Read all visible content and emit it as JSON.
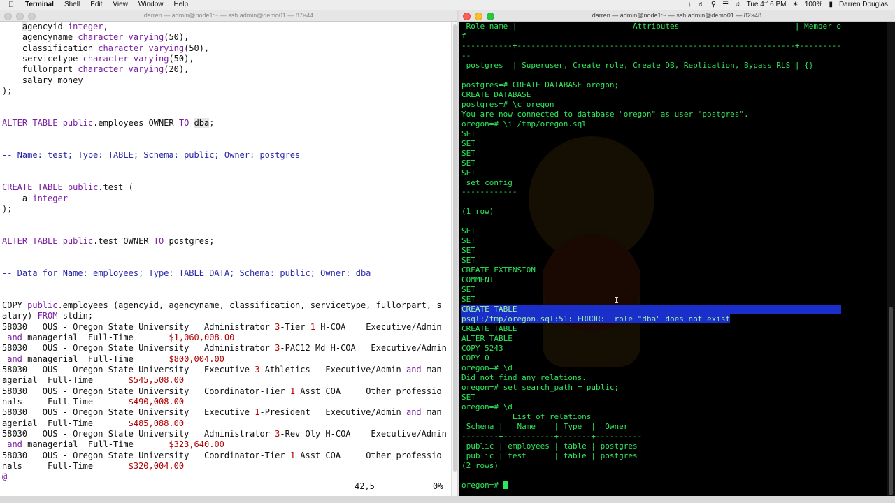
{
  "menubar": {
    "app": "Terminal",
    "menus": [
      "Shell",
      "Edit",
      "View",
      "Window",
      "Help"
    ],
    "clock": "Tue 4:16 PM",
    "battery": "100%",
    "user": "Darren Douglas"
  },
  "left_window": {
    "title": "darren — admin@node1:~ — ssh admin@demo01 — 87×44",
    "status_pos": "42,5",
    "status_pct": "0%"
  },
  "right_window": {
    "title": "darren — admin@node1:~ — ssh admin@demo01 — 82×48"
  },
  "vim_lines": [
    [
      {
        "t": "    "
      },
      {
        "t": "a",
        "c": "hl"
      },
      {
        "t": "gencyid "
      },
      {
        "t": "integer",
        "c": "kw"
      },
      {
        "t": ","
      }
    ],
    [
      {
        "t": "    agencyname "
      },
      {
        "t": "character varying",
        "c": "kw"
      },
      {
        "t": "("
      },
      {
        "t": "50",
        "c": ""
      },
      {
        "t": "),"
      }
    ],
    [
      {
        "t": "    classification "
      },
      {
        "t": "character varying",
        "c": "kw"
      },
      {
        "t": "(50),"
      }
    ],
    [
      {
        "t": "    servicetype "
      },
      {
        "t": "character varying",
        "c": "kw"
      },
      {
        "t": "(50),"
      }
    ],
    [
      {
        "t": "    fullorpart "
      },
      {
        "t": "character varying",
        "c": "kw"
      },
      {
        "t": "(20),"
      }
    ],
    [
      {
        "t": "    salary money"
      }
    ],
    [
      {
        "t": ");"
      }
    ],
    [
      {
        "t": ""
      }
    ],
    [
      {
        "t": ""
      }
    ],
    [
      {
        "t": "ALTER TABLE ",
        "c": "kw"
      },
      {
        "t": "public",
        "c": "kw"
      },
      {
        "t": ".employees OWNER "
      },
      {
        "t": "TO",
        "c": "kw"
      },
      {
        "t": " "
      },
      {
        "t": "dba",
        "c": "hl"
      },
      {
        "t": ";"
      }
    ],
    [
      {
        "t": ""
      }
    ],
    [
      {
        "t": "--",
        "c": "cm"
      }
    ],
    [
      {
        "t": "-- Name: test; Type: TABLE; Schema: public; Owner: postgres",
        "c": "cm"
      }
    ],
    [
      {
        "t": "--",
        "c": "cm"
      }
    ],
    [
      {
        "t": ""
      }
    ],
    [
      {
        "t": "CREATE TABLE ",
        "c": "kw"
      },
      {
        "t": "public",
        "c": "kw"
      },
      {
        "t": ".test ("
      }
    ],
    [
      {
        "t": "    a "
      },
      {
        "t": "integer",
        "c": "kw"
      }
    ],
    [
      {
        "t": ");"
      }
    ],
    [
      {
        "t": ""
      }
    ],
    [
      {
        "t": ""
      }
    ],
    [
      {
        "t": "ALTER TABLE ",
        "c": "kw"
      },
      {
        "t": "public",
        "c": "kw"
      },
      {
        "t": ".test OWNER "
      },
      {
        "t": "TO",
        "c": "kw"
      },
      {
        "t": " postgres;"
      }
    ],
    [
      {
        "t": ""
      }
    ],
    [
      {
        "t": "--",
        "c": "cm"
      }
    ],
    [
      {
        "t": "-- Data for Name: employees; Type: TABLE DATA; Schema: public; Owner: dba",
        "c": "cm"
      }
    ],
    [
      {
        "t": "--",
        "c": "cm"
      }
    ],
    [
      {
        "t": ""
      }
    ],
    [
      {
        "t": "COPY "
      },
      {
        "t": "public",
        "c": "kw"
      },
      {
        "t": ".employees (agencyid, agencyname, classification, servicetype, fullorpart, s"
      }
    ],
    [
      {
        "t": "alary) "
      },
      {
        "t": "FROM",
        "c": "kw"
      },
      {
        "t": " stdin;"
      }
    ],
    [
      {
        "t": "58030   OUS - Oregon State University   Administrator "
      },
      {
        "t": "3",
        "c": "num"
      },
      {
        "t": "-Tier "
      },
      {
        "t": "1",
        "c": "num"
      },
      {
        "t": " H-COA    Executive/Admin"
      }
    ],
    [
      {
        "t": " "
      },
      {
        "t": "and",
        "c": "kw"
      },
      {
        "t": " managerial  Full-Time       "
      },
      {
        "t": "$1,060,008.00",
        "c": "num"
      }
    ],
    [
      {
        "t": "58030   OUS - Oregon State University   Administrator "
      },
      {
        "t": "3",
        "c": "num"
      },
      {
        "t": "-PAC12 Md H-COA   Executive/Admin"
      }
    ],
    [
      {
        "t": " "
      },
      {
        "t": "and",
        "c": "kw"
      },
      {
        "t": " managerial  Full-Time       "
      },
      {
        "t": "$800,004.00",
        "c": "num"
      }
    ],
    [
      {
        "t": "58030   OUS - Oregon State University   Executive "
      },
      {
        "t": "3",
        "c": "num"
      },
      {
        "t": "-Athletics   Executive/Admin "
      },
      {
        "t": "and",
        "c": "kw"
      },
      {
        "t": " man"
      }
    ],
    [
      {
        "t": "agerial  Full-Time       "
      },
      {
        "t": "$545,508.00",
        "c": "num"
      }
    ],
    [
      {
        "t": "58030   OUS - Oregon State University   Coordinator-Tier "
      },
      {
        "t": "1",
        "c": "num"
      },
      {
        "t": " Asst COA     Other professio"
      }
    ],
    [
      {
        "t": "nals     Full-Time       "
      },
      {
        "t": "$490,008.00",
        "c": "num"
      }
    ],
    [
      {
        "t": "58030   OUS - Oregon State University   Executive "
      },
      {
        "t": "1",
        "c": "num"
      },
      {
        "t": "-President   Executive/Admin "
      },
      {
        "t": "and",
        "c": "kw"
      },
      {
        "t": " man"
      }
    ],
    [
      {
        "t": "agerial  Full-Time       "
      },
      {
        "t": "$485,088.00",
        "c": "num"
      }
    ],
    [
      {
        "t": "58030   OUS - Oregon State University   Administrator "
      },
      {
        "t": "3",
        "c": "num"
      },
      {
        "t": "-Rev Oly H-COA    Executive/Admin"
      }
    ],
    [
      {
        "t": " "
      },
      {
        "t": "and",
        "c": "kw"
      },
      {
        "t": " managerial  Full-Time       "
      },
      {
        "t": "$323,640.00",
        "c": "num"
      }
    ],
    [
      {
        "t": "58030   OUS - Oregon State University   Coordinator-Tier "
      },
      {
        "t": "1",
        "c": "num"
      },
      {
        "t": " Asst COA     Other professio"
      }
    ],
    [
      {
        "t": "nals     Full-Time       "
      },
      {
        "t": "$320,004.00",
        "c": "num"
      }
    ],
    [
      {
        "t": "@",
        "c": "kw"
      }
    ]
  ],
  "psql_lines": [
    {
      "t": " Role name |                         Attributes                         | Member o"
    },
    {
      "t": "f"
    },
    {
      "t": "-----------+------------------------------------------------------------+---------"
    },
    {
      "t": "--"
    },
    {
      "t": " postgres  | Superuser, Create role, Create DB, Replication, Bypass RLS | {}"
    },
    {
      "t": ""
    },
    {
      "t": "postgres=# CREATE DATABASE oregon;"
    },
    {
      "t": "CREATE DATABASE"
    },
    {
      "t": "postgres=# \\c oregon"
    },
    {
      "t": "You are now connected to database \"oregon\" as user \"postgres\"."
    },
    {
      "t": "oregon=# \\i /tmp/oregon.sql"
    },
    {
      "t": "SET"
    },
    {
      "t": "SET"
    },
    {
      "t": "SET"
    },
    {
      "t": "SET"
    },
    {
      "t": "SET"
    },
    {
      "t": " set_config"
    },
    {
      "t": "------------"
    },
    {
      "t": ""
    },
    {
      "t": "(1 row)"
    },
    {
      "t": ""
    },
    {
      "t": "SET"
    },
    {
      "t": "SET"
    },
    {
      "t": "SET"
    },
    {
      "t": "SET"
    },
    {
      "t": "CREATE EXTENSION"
    },
    {
      "t": "COMMENT"
    },
    {
      "t": "SET"
    },
    {
      "t": "SET"
    },
    {
      "t": "CREATE TABLE                                                                      ",
      "sel": true
    },
    {
      "t": "psql:/tmp/oregon.sql:51: ERROR:  role \"dba\" does not exist",
      "sel": true
    },
    {
      "t": "CREATE TABLE"
    },
    {
      "t": "ALTER TABLE"
    },
    {
      "t": "COPY 5243"
    },
    {
      "t": "COPY 0"
    },
    {
      "t": "oregon=# \\d"
    },
    {
      "t": "Did not find any relations."
    },
    {
      "t": "oregon=# set search_path = public;"
    },
    {
      "t": "SET"
    },
    {
      "t": "oregon=# \\d"
    },
    {
      "t": "           List of relations"
    },
    {
      "t": " Schema |   Name    | Type  |  Owner"
    },
    {
      "t": "--------+-----------+-------+----------"
    },
    {
      "t": " public | employees | table | postgres"
    },
    {
      "t": " public | test      | table | postgres"
    },
    {
      "t": "(2 rows)"
    },
    {
      "t": ""
    },
    {
      "t": "oregon=# ",
      "cursor": true
    }
  ]
}
